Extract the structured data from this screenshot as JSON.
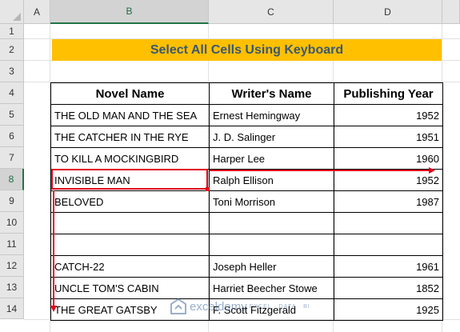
{
  "columns": [
    "A",
    "B",
    "C",
    "D"
  ],
  "rows": [
    "1",
    "2",
    "3",
    "4",
    "5",
    "6",
    "7",
    "8",
    "9",
    "10",
    "11",
    "12",
    "13",
    "14"
  ],
  "selected_column": "B",
  "selected_row": "8",
  "title": "Select All Cells Using Keyboard",
  "table": {
    "headers": [
      "Novel Name",
      "Writer's Name",
      "Publishing Year"
    ],
    "rows": [
      {
        "novel": "THE OLD MAN AND THE SEA",
        "writer": "Ernest Hemingway",
        "year": "1952"
      },
      {
        "novel": "THE CATCHER IN THE RYE",
        "writer": "J. D. Salinger",
        "year": "1951"
      },
      {
        "novel": "TO KILL A MOCKINGBIRD",
        "writer": "Harper Lee",
        "year": "1960"
      },
      {
        "novel": "INVISIBLE MAN",
        "writer": "Ralph Ellison",
        "year": "1952"
      },
      {
        "novel": "BELOVED",
        "writer": "Toni Morrison",
        "year": "1987"
      },
      {
        "novel": "",
        "writer": "",
        "year": ""
      },
      {
        "novel": "",
        "writer": "",
        "year": ""
      },
      {
        "novel": "CATCH-22",
        "writer": "Joseph Heller",
        "year": "1961"
      },
      {
        "novel": "UNCLE TOM'S CABIN",
        "writer": "Harriet Beecher Stowe",
        "year": "1852"
      },
      {
        "novel": "THE GREAT GATSBY",
        "writer": "F. Scott Fitzgerald",
        "year": "1925"
      }
    ]
  },
  "watermark": {
    "name": "exceldemy",
    "tagline": "EXCEL · DATA · BI"
  },
  "colors": {
    "title_fill": "#ffc000",
    "title_text": "#3a5774",
    "arrow": "#e0001b",
    "selection": "#217346"
  }
}
